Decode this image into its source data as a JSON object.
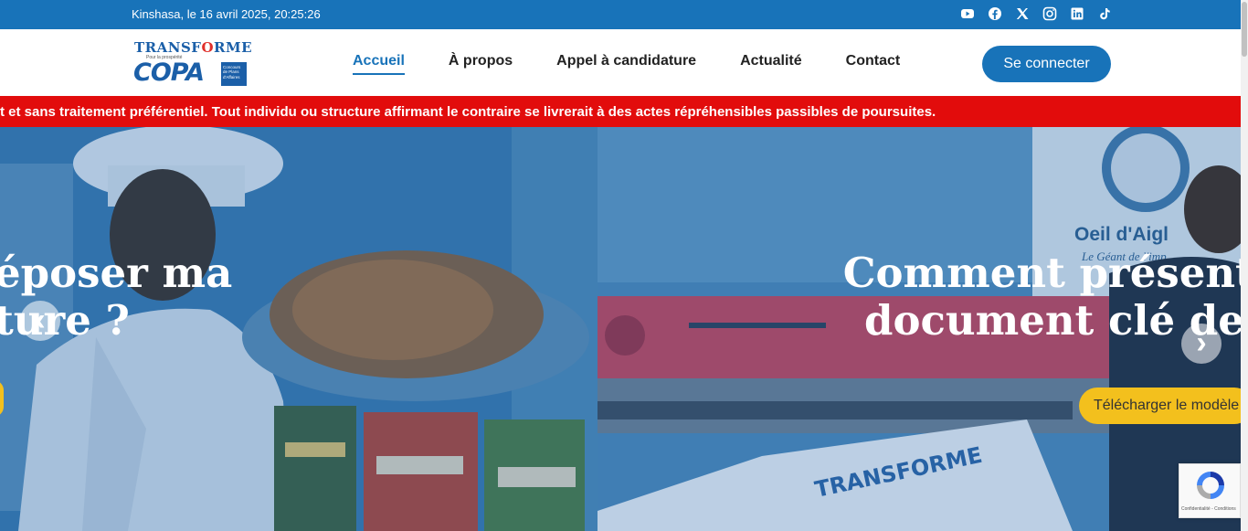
{
  "topbar": {
    "datetime": "Kinshasa, le 16 avril 2025, 20:25:26",
    "socials": [
      "youtube-icon",
      "facebook-icon",
      "x-icon",
      "instagram-icon",
      "linkedin-icon",
      "tiktok-icon"
    ]
  },
  "logo": {
    "line1_left": "TRANSF",
    "line1_gear": "O",
    "line1_right": "RME",
    "tagline": "Pour la prospérité",
    "line2": "COPA",
    "box_text": "Concours de Plans d'Affaires"
  },
  "nav": {
    "items": [
      "Accueil",
      "À propos",
      "Appel à candidature",
      "Actualité",
      "Contact"
    ],
    "active": "Accueil",
    "login_label": "Se connecter"
  },
  "ticker": {
    "text": "t et sans traitement préférentiel. Tout individu ou structure affirmant le contraire se livrerait à des actes répréhensibles passibles de poursuites."
  },
  "slider": {
    "slide1": {
      "title_line1": "époser ma",
      "title_line2": "ture ?"
    },
    "slide2": {
      "title_line1": "Comment présenter",
      "title_line2": "document clé de m",
      "cta_label": "Télécharger le modèle d"
    },
    "prev_arrow": "‹",
    "next_arrow": "›",
    "sign_text_1": "Oeil d'Aigl",
    "sign_text_2": "Le Géant de l'imp",
    "banner_text": "TRANSFORME"
  },
  "recaptcha": {
    "text": "Confidentialité - Conditions"
  },
  "colors": {
    "primary": "#1873b9",
    "ticker": "#e20c0c",
    "cta": "#f3c01d"
  }
}
